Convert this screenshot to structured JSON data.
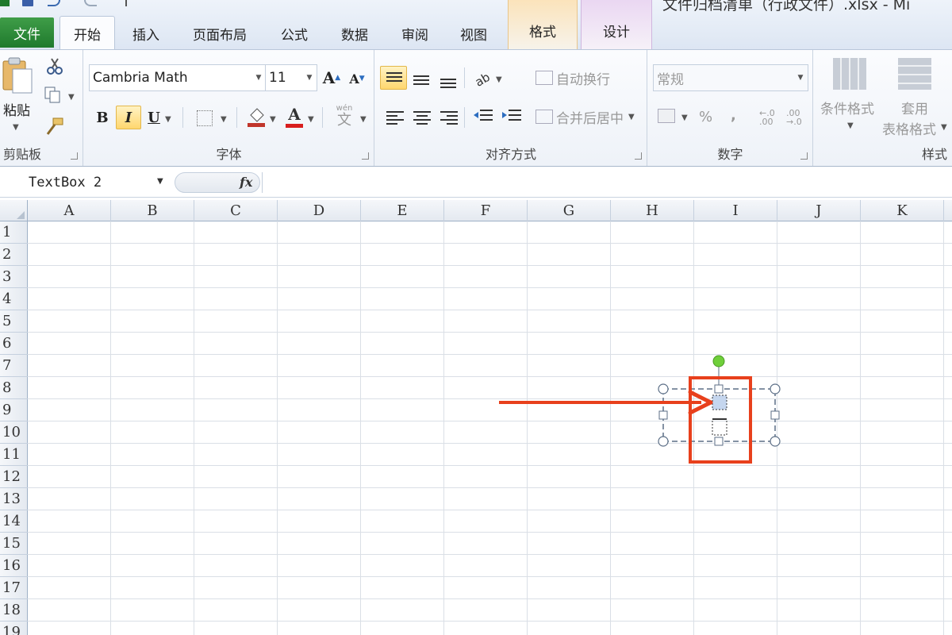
{
  "window": {
    "title": "文件归档清单（行政文件）.xlsx - Mi"
  },
  "tabs": {
    "file": "文件",
    "home": "开始",
    "insert": "插入",
    "page_layout": "页面布局",
    "formulas": "公式",
    "data": "数据",
    "review": "审阅",
    "view": "视图",
    "ctx_format": "格式",
    "ctx_design": "设计"
  },
  "ribbon": {
    "clipboard": {
      "paste": "粘贴",
      "label": "剪贴板"
    },
    "font": {
      "name": "Cambria Math",
      "size": "11",
      "bold": "B",
      "italic": "I",
      "underline": "U",
      "font_color_glyph": "A",
      "phonetic_glyph": "wén",
      "phonetic_char": "文",
      "grow_glyph": "A",
      "shrink_glyph": "A",
      "label": "字体"
    },
    "alignment": {
      "wrap_text": "自动换行",
      "merge_center": "合并后居中",
      "label": "对齐方式"
    },
    "number": {
      "format": "常规",
      "percent": "%",
      "comma": ",",
      "label": "数字"
    },
    "styles": {
      "conditional": "条件格式",
      "table_1": "套用",
      "table_2": "表格格式",
      "label": "样式"
    }
  },
  "formula_bar": {
    "name_box": "TextBox 2",
    "fx": "fx",
    "formula": ""
  },
  "sheet": {
    "columns": [
      "A",
      "B",
      "C",
      "D",
      "E",
      "F",
      "G",
      "H",
      "I",
      "J",
      "K"
    ],
    "rows": [
      "1",
      "2",
      "3",
      "4",
      "5",
      "6",
      "7",
      "8",
      "9",
      "10",
      "11",
      "12",
      "13",
      "14",
      "15",
      "16",
      "17",
      "18",
      "19"
    ]
  },
  "colors": {
    "file_tab": "#2a8a37",
    "ctx_format_tab": "#f5b04a",
    "ctx_design_tab": "#c8a6dc",
    "annotation": "#e8401c",
    "rotation_handle": "#6fcf3a",
    "selection_frame": "#5b6e86"
  }
}
